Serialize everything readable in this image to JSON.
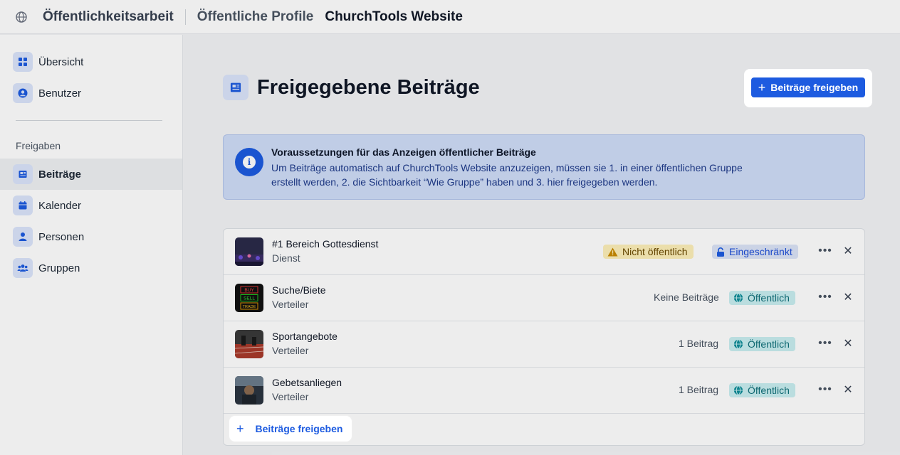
{
  "topbar": {
    "breadcrumbs": [
      "Öffentlichkeitsarbeit",
      "Öffentliche Profile",
      "ChurchTools Website"
    ]
  },
  "sidebar": {
    "items": [
      {
        "label": "Übersicht",
        "icon": "grid-icon"
      },
      {
        "label": "Benutzer",
        "icon": "user-circle-icon"
      }
    ],
    "section_label": "Freigaben",
    "shares": [
      {
        "label": "Beiträge",
        "icon": "newspaper-icon",
        "active": true
      },
      {
        "label": "Kalender",
        "icon": "calendar-icon"
      },
      {
        "label": "Personen",
        "icon": "person-icon"
      },
      {
        "label": "Gruppen",
        "icon": "users-icon"
      }
    ]
  },
  "main": {
    "title": "Freigegebene Beiträge",
    "primary_button": "Beiträge freigeben",
    "info": {
      "title": "Voraussetzungen für das Anzeigen öffentlicher Beiträge",
      "text": "Um Beiträge automatisch auf ChurchTools Website anzuzeigen, müssen sie 1. in einer öffentlichen Gruppe erstellt werden, 2. die Sichtbarkeit “Wie Gruppe” haben und 3. hier freigegeben werden."
    },
    "rows": [
      {
        "name": "#1 Bereich Gottesdienst",
        "type": "Dienst",
        "count": "",
        "badges": [
          {
            "label": "Nicht öffentlich",
            "kind": "warning"
          },
          {
            "label": "Eingeschränkt",
            "kind": "restricted"
          }
        ]
      },
      {
        "name": "Suche/Biete",
        "type": "Verteiler",
        "count": "Keine Beiträge",
        "badges": [
          {
            "label": "Öffentlich",
            "kind": "public"
          }
        ],
        "thumb_text": [
          "BUY",
          "SELL",
          "TRADE"
        ]
      },
      {
        "name": "Sportangebote",
        "type": "Verteiler",
        "count": "1 Beitrag",
        "badges": [
          {
            "label": "Öffentlich",
            "kind": "public"
          }
        ]
      },
      {
        "name": "Gebetsanliegen",
        "type": "Verteiler",
        "count": "1 Beitrag",
        "badges": [
          {
            "label": "Öffentlich",
            "kind": "public"
          }
        ]
      }
    ],
    "add_button": "Beiträge freigeben"
  },
  "colors": {
    "accent": "#1d5be0",
    "info_bg": "#cfddf8",
    "warning_bg": "#fdefb8",
    "public_bg": "#c9eef0"
  }
}
